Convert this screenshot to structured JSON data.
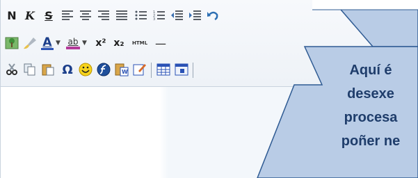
{
  "toolbar": {
    "row1": {
      "bold": "N",
      "italic": "K",
      "strike": "S"
    },
    "row2": {
      "font_color": "A",
      "bg_color": "ab",
      "superscript": "x²",
      "subscript": "x₂",
      "html_source": "HTML",
      "horizontal_rule": "—"
    },
    "row3": {
      "special_char": "Ω"
    }
  },
  "callout": {
    "lines": [
      "Aquí é",
      "desexe",
      "procesa",
      "poñer ne"
    ],
    "fill": "#b9cce6",
    "stroke": "#2f5b93"
  }
}
